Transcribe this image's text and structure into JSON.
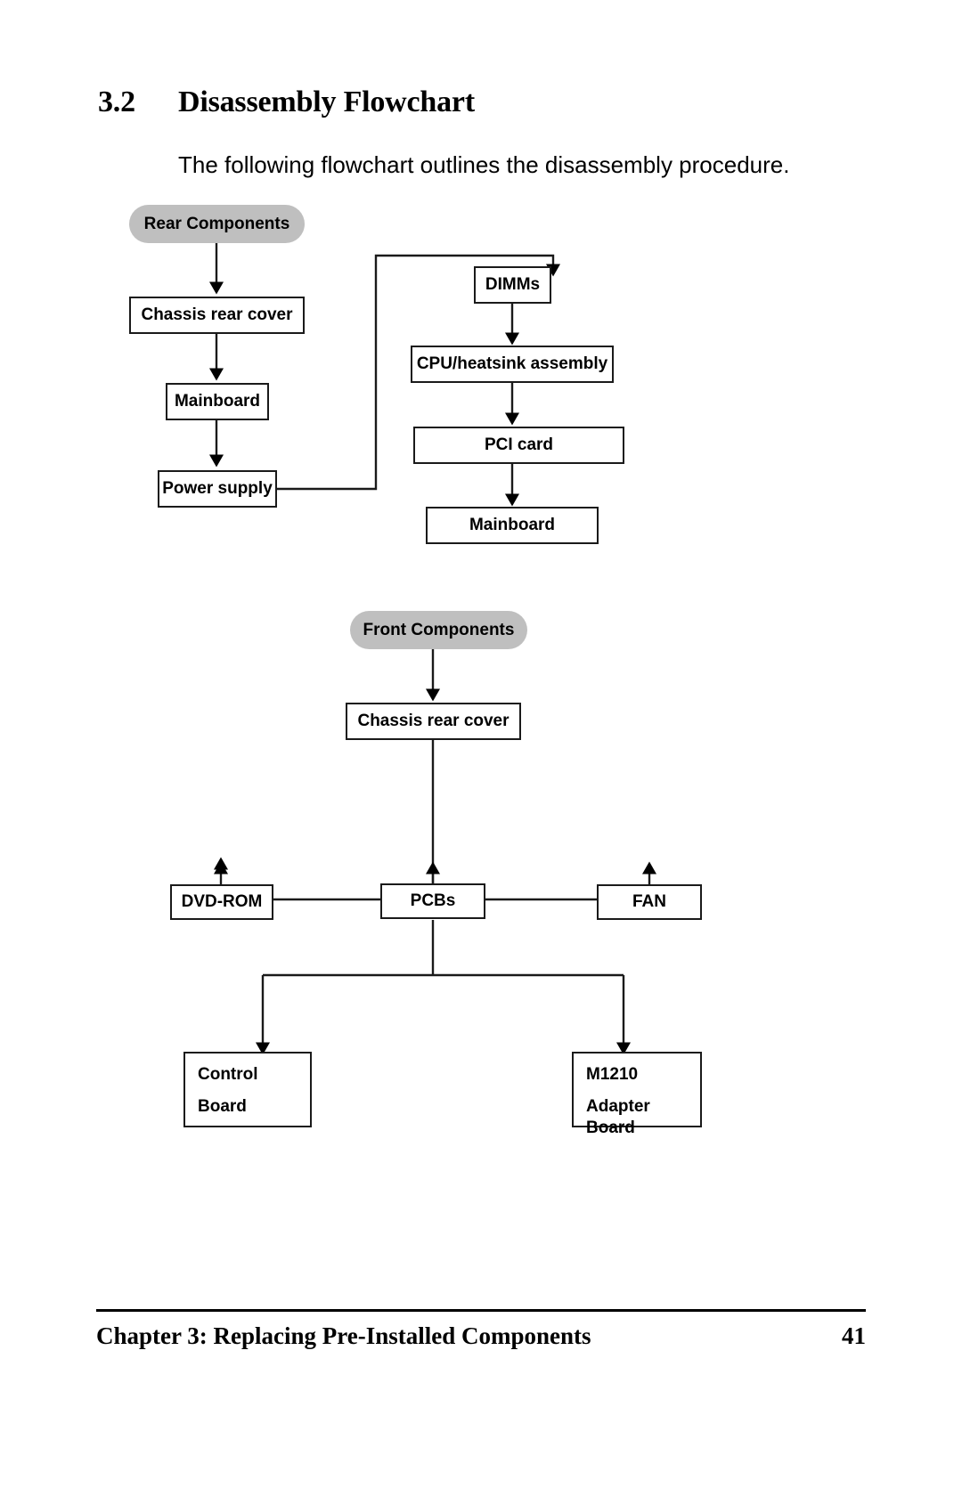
{
  "heading": {
    "number": "3.2",
    "title": "Disassembly Flowchart"
  },
  "intro": "The following flowchart outlines the disassembly procedure.",
  "flowchart": {
    "rear": {
      "start_label": "Rear Components",
      "left_chain": [
        "Chassis rear cover",
        "Mainboard",
        "Power supply"
      ],
      "right_chain": [
        "DIMMs",
        "CPU/heatsink assembly",
        "PCI card",
        "Mainboard"
      ]
    },
    "front": {
      "start_label": "Front Components",
      "cover_label": "Chassis rear cover",
      "branch": [
        "DVD-ROM",
        "PCBs",
        "FAN"
      ],
      "pcb_children": [
        {
          "line1": "Control",
          "line2": "Board"
        },
        {
          "line1": "M1210",
          "line2": "Adapter Board"
        }
      ]
    }
  },
  "footer": {
    "chapter": "Chapter 3: Replacing Pre-Installed Components",
    "page": "41"
  },
  "colors": {
    "pill_fill": "#bfbfbf",
    "stroke": "#1a1a1a",
    "text": "#000000",
    "page_background": "#ffffff"
  }
}
